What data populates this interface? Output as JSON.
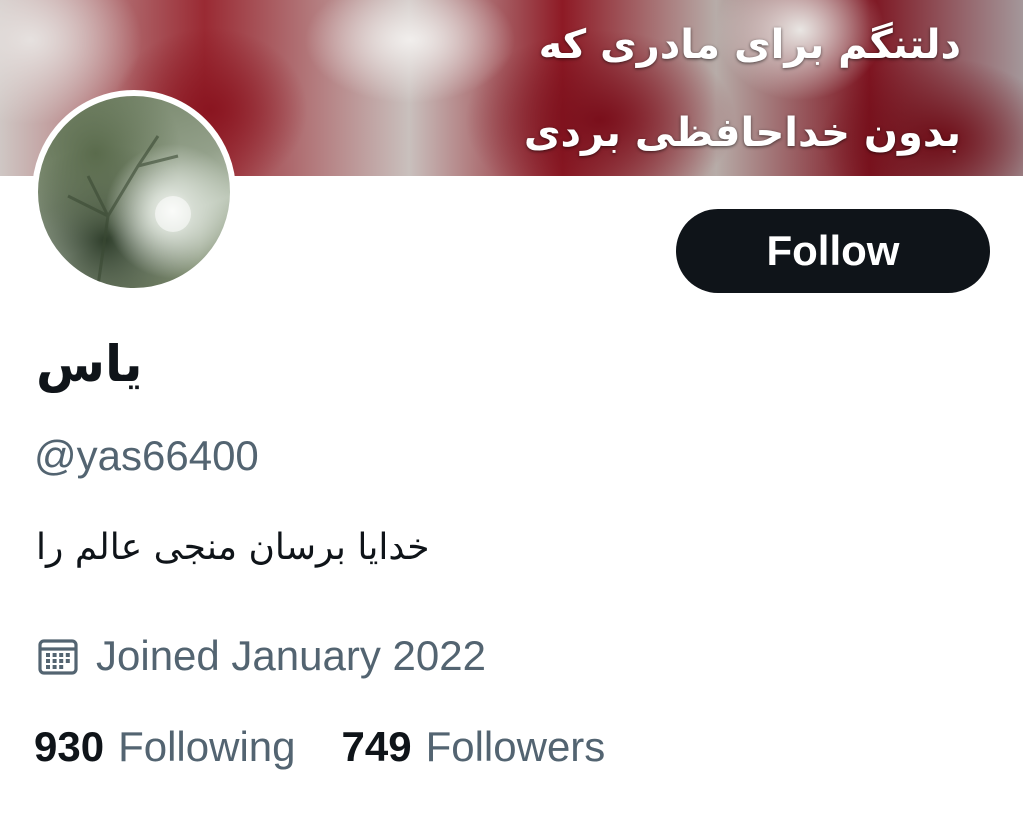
{
  "banner": {
    "line1": "دلتنگم برای مادری که",
    "line2": "بدون خداحافظی بردی"
  },
  "profile": {
    "display_name": "یاس",
    "handle": "@yas66400",
    "bio": "خدایا برسان منجی عالم را",
    "joined": "Joined January 2022",
    "following_count": "930",
    "following_label": "Following",
    "followers_count": "749",
    "followers_label": "Followers"
  },
  "actions": {
    "follow_label": "Follow"
  },
  "icons": {
    "joined": "calendar-icon"
  },
  "colors": {
    "primary_text": "#0f1419",
    "secondary_text": "#536471",
    "follow_button_bg": "#0f1419",
    "follow_button_text": "#ffffff"
  }
}
